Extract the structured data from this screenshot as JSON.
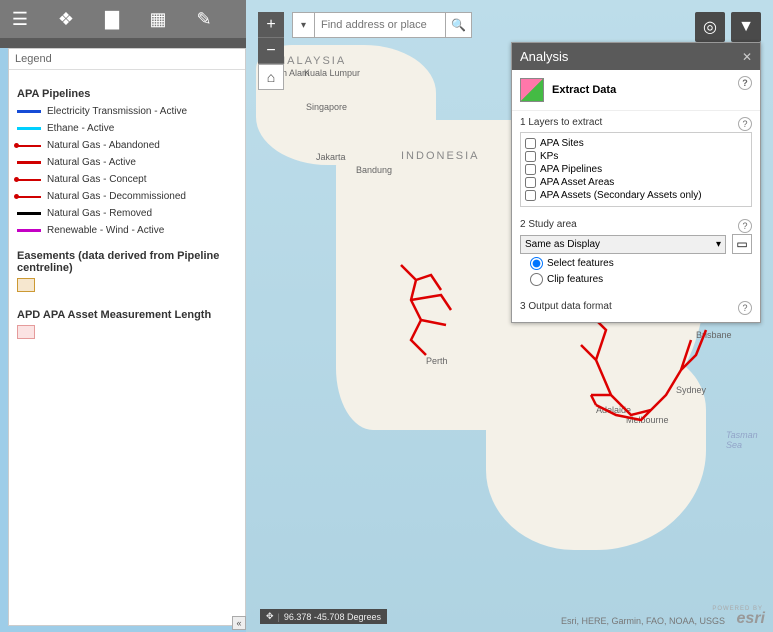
{
  "legend": {
    "header": "Legend",
    "group1_title": "APA Pipelines",
    "items": [
      {
        "label": "Electricity Transmission - Active",
        "color": "#154bd6",
        "kind": "line"
      },
      {
        "label": "Ethane - Active",
        "color": "#00d0ff",
        "kind": "line"
      },
      {
        "label": "Natural Gas - Abandoned",
        "color": "#d00000",
        "kind": "dot"
      },
      {
        "label": "Natural Gas - Active",
        "color": "#d00000",
        "kind": "line"
      },
      {
        "label": "Natural Gas - Concept",
        "color": "#d00000",
        "kind": "dot"
      },
      {
        "label": "Natural Gas - Decommissioned",
        "color": "#d00000",
        "kind": "dot"
      },
      {
        "label": "Natural Gas - Removed",
        "color": "#000000",
        "kind": "line"
      },
      {
        "label": "Renewable - Wind - Active",
        "color": "#c400c4",
        "kind": "line"
      }
    ],
    "group2_title": "Easements (data derived from Pipeline centreline)",
    "group2_swatch_fill": "#f6e7cf",
    "group2_swatch_border": "#cc9933",
    "group3_title": "APD APA Asset Measurement Length",
    "group3_swatch_fill": "#fbe3e3",
    "group3_swatch_border": "#e59b9b"
  },
  "search": {
    "placeholder": "Find address or place"
  },
  "analysis": {
    "title": "Analysis",
    "tool_label": "Extract Data",
    "s1_title": "1 Layers to extract",
    "layers": [
      "APA Sites",
      "KPs",
      "APA Pipelines",
      "APA Asset Areas",
      "APA Assets (Secondary Assets only)"
    ],
    "s2_title": "2 Study area",
    "study_value": "Same as Display",
    "r1": "Select features",
    "r2": "Clip features",
    "s3_title": "3 Output data format"
  },
  "map_labels": {
    "indonesia": "INDONESIA",
    "malaysia": "MALAYSIA",
    "singapore": "Singapore",
    "jakarta": "Jakarta",
    "bandung": "Bandung",
    "kl": "Kuala Lumpur",
    "shah": "Shah Alam",
    "perth": "Perth",
    "adelaide": "Adelaide",
    "melbourne": "Melbourne",
    "sydney": "Sydney",
    "brisbane": "Brisbane",
    "tasman": "Tasman Sea"
  },
  "footer": {
    "coords": "96.378 -45.708 Degrees",
    "credits": "Esri, HERE, Garmin, FAO, NOAA, USGS",
    "powered": "POWERED BY",
    "esri": "esri"
  }
}
